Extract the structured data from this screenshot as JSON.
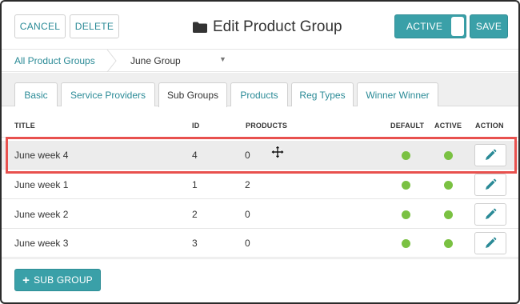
{
  "header": {
    "cancel_label": "CANCEL",
    "delete_label": "DELETE",
    "title": "Edit Product Group",
    "title_icon": "folder-icon",
    "toggle_label": "ACTIVE",
    "toggle_on": true,
    "save_label": "SAVE"
  },
  "breadcrumb": {
    "parent": "All Product Groups",
    "current": "June Group",
    "caret": "▼"
  },
  "tabs": [
    {
      "label": "Basic",
      "active": false
    },
    {
      "label": "Service Providers",
      "active": false
    },
    {
      "label": "Sub Groups",
      "active": true
    },
    {
      "label": "Products",
      "active": false
    },
    {
      "label": "Reg Types",
      "active": false
    },
    {
      "label": "Winner Winner",
      "active": false
    }
  ],
  "table": {
    "columns": [
      "TITLE",
      "ID",
      "PRODUCTS",
      "DEFAULT",
      "ACTIVE",
      "ACTION"
    ],
    "rows": [
      {
        "title": "June week 4",
        "id": "4",
        "products": "0",
        "default": true,
        "active": true,
        "highlighted": true
      },
      {
        "title": "June week 1",
        "id": "1",
        "products": "2",
        "default": true,
        "active": true,
        "highlighted": false
      },
      {
        "title": "June week 2",
        "id": "2",
        "products": "0",
        "default": true,
        "active": true,
        "highlighted": false
      },
      {
        "title": "June week 3",
        "id": "3",
        "products": "0",
        "default": true,
        "active": true,
        "highlighted": false
      }
    ]
  },
  "footer": {
    "add_label": "SUB GROUP",
    "add_icon": "plus-icon"
  },
  "colors": {
    "accent": "#3aa0a8",
    "link": "#2a8a96",
    "status_green": "#7ac142",
    "highlight_border": "#e8514e"
  }
}
